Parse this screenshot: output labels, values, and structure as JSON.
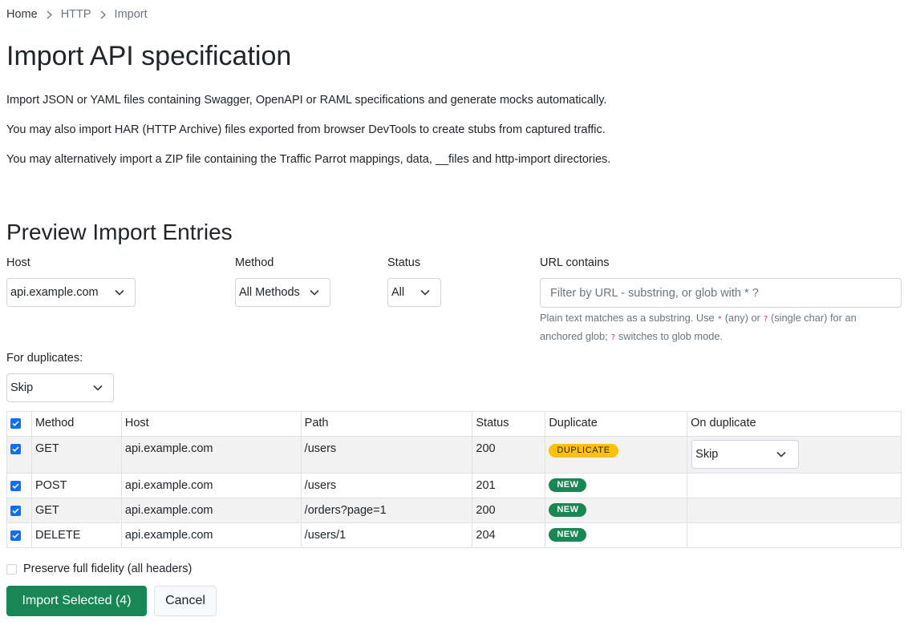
{
  "breadcrumb": {
    "home": "Home",
    "section": "HTTP",
    "current": "Import"
  },
  "page": {
    "title": "Import API specification",
    "desc1": "Import JSON or YAML files containing Swagger, OpenAPI or RAML specifications and generate mocks automatically.",
    "desc2": "You may also import HAR (HTTP Archive) files exported from browser DevTools to create stubs from captured traffic.",
    "desc3": "You may alternatively import a ZIP file containing the Traffic Parrot mappings, data, __files and http-import directories."
  },
  "preview": {
    "title": "Preview Import Entries",
    "filters": {
      "host_label": "Host",
      "host_value": "api.example.com",
      "method_label": "Method",
      "method_value": "All Methods",
      "status_label": "Status",
      "status_value": "All",
      "url_label": "URL contains",
      "url_placeholder": "Filter by URL - substring, or glob with * ?",
      "help_1": "Plain text matches as a substring. Use ",
      "help_star": "*",
      "help_2": " (any) or ",
      "help_q": "?",
      "help_3": " (single char) for an anchored glob; ",
      "help_q2": "?",
      "help_4": " switches to glob mode."
    },
    "duplicates": {
      "label": "For duplicates:",
      "value": "Skip"
    },
    "table": {
      "headers": {
        "method": "Method",
        "host": "Host",
        "path": "Path",
        "status": "Status",
        "duplicate": "Duplicate",
        "on_duplicate": "On duplicate"
      },
      "rows": [
        {
          "method": "GET",
          "host": "api.example.com",
          "path": "/users",
          "status": "200",
          "badge": "DUPLICATE",
          "on_duplicate": "Skip"
        },
        {
          "method": "POST",
          "host": "api.example.com",
          "path": "/users",
          "status": "201",
          "badge": "NEW"
        },
        {
          "method": "GET",
          "host": "api.example.com",
          "path": "/orders?page=1",
          "status": "200",
          "badge": "NEW"
        },
        {
          "method": "DELETE",
          "host": "api.example.com",
          "path": "/users/1",
          "status": "204",
          "badge": "NEW"
        }
      ]
    },
    "fidelity_label": "Preserve full fidelity (all headers)",
    "import_button": "Import Selected (4)",
    "cancel_button": "Cancel"
  },
  "colors": {
    "primary": "#0d6efd",
    "success": "#198754",
    "warning": "#ffc107",
    "text": "#212529",
    "muted": "#6c757d",
    "code": "#d63384"
  },
  "icons": {
    "separator": "chevron-right-icon",
    "dropdown": "chevron-down-icon",
    "checkbox": "check-icon"
  }
}
